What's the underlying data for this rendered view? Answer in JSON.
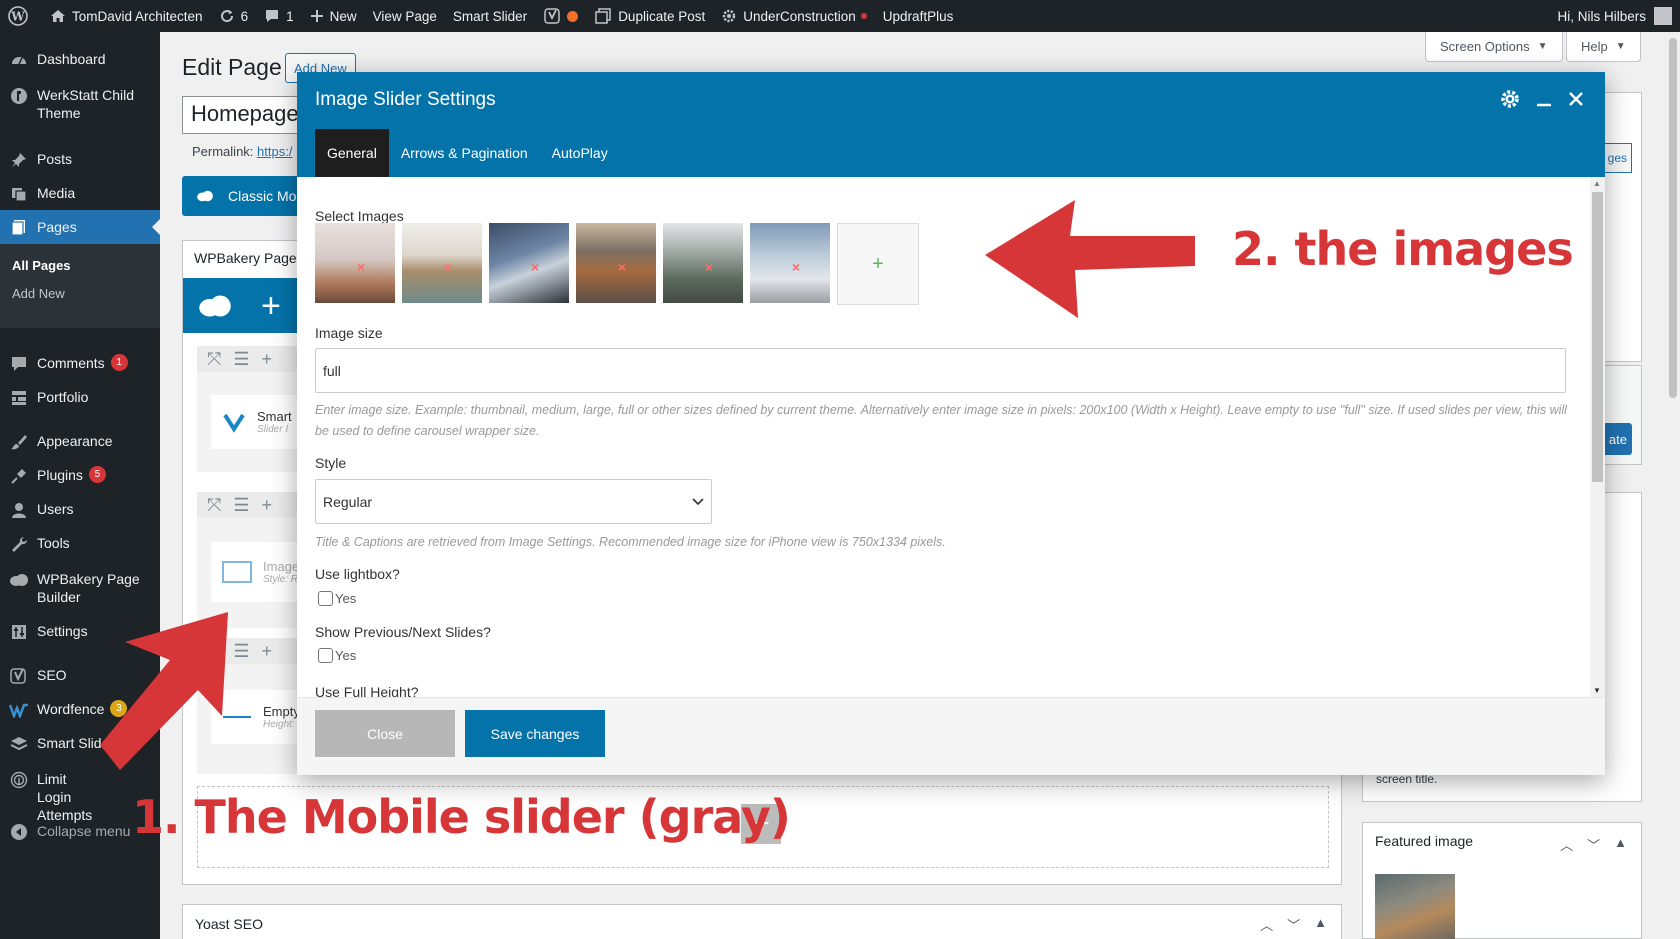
{
  "adminbar": {
    "site_name": "TomDavid Architecten",
    "updates_count": "6",
    "comments_count": "1",
    "new_label": "New",
    "view_page": "View Page",
    "smart_slider": "Smart Slider",
    "duplicate_post": "Duplicate Post",
    "under_construction": "UnderConstruction",
    "updraftplus": "UpdraftPlus",
    "greeting": "Hi, Nils Hilbers"
  },
  "sidebar": {
    "items": [
      {
        "label": "Dashboard"
      },
      {
        "label": "WerkStatt Child Theme"
      },
      {
        "label": "Posts"
      },
      {
        "label": "Media"
      },
      {
        "label": "Pages"
      },
      {
        "label": "Comments",
        "badge": "1"
      },
      {
        "label": "Portfolio"
      },
      {
        "label": "Appearance"
      },
      {
        "label": "Plugins",
        "badge": "5"
      },
      {
        "label": "Users"
      },
      {
        "label": "Tools"
      },
      {
        "label": "WPBakery Page Builder"
      },
      {
        "label": "Settings"
      },
      {
        "label": "SEO"
      },
      {
        "label": "Wordfence",
        "badge": "3"
      },
      {
        "label": "Smart Slider"
      },
      {
        "label": "Limit Login Attempts"
      },
      {
        "label": "Collapse menu"
      }
    ],
    "submenu": {
      "all_pages": "All Pages",
      "add_new": "Add New"
    }
  },
  "screen_options": "Screen Options",
  "help": "Help",
  "editor": {
    "title": "Edit Page",
    "add_new": "Add New",
    "page_title_value": "Homepage",
    "permalink_label": "Permalink:",
    "permalink_url": "https:/",
    "classic_mode": "Classic Mo",
    "wpbakery_title": "WPBakery Page",
    "el1_title": "Smart",
    "el1_sub": "Slider I",
    "el2_title": "Image",
    "el2_sub": "Style: R",
    "el3_title": "Empty",
    "el3_sub": "Height:",
    "yoast": "Yoast SEO",
    "side_outline_btn": "ges",
    "side_blue_btn": "ate",
    "screen_title_text": "screen title.",
    "featured_image": "Featured image"
  },
  "modal": {
    "title": "Image Slider Settings",
    "tabs": [
      "General",
      "Arrows & Pagination",
      "AutoPlay"
    ],
    "select_images": "Select Images",
    "image_size_label": "Image size",
    "image_size_value": "full",
    "image_size_help": "Enter image size. Example: thumbnail, medium, large, full or other sizes defined by current theme. Alternatively enter image size in pixels: 200x100 (Width x Height). Leave empty to use \"full\" size. If used slides per view, this will be used to define carousel wrapper size.",
    "style_label": "Style",
    "style_value": "Regular",
    "style_help": "Title & Captions are retrieved from Image Settings. Recommended image size for iPhone view is 750x1334 pixels.",
    "lightbox_label": "Use lightbox?",
    "prevnext_label": "Show Previous/Next Slides?",
    "fullheight_label": "Use Full Height?",
    "yes": "Yes",
    "close": "Close",
    "save": "Save changes"
  },
  "annotations": {
    "one": "1. The Mobile slider (gray)",
    "two": "2. the images"
  },
  "colors": {
    "wp_dark": "#1d2327",
    "wp_blue": "#2271b1",
    "modal_blue": "#0473aa",
    "annotation_red": "#d63638"
  }
}
